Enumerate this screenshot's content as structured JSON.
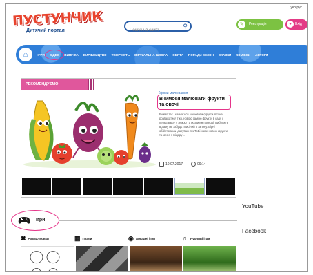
{
  "header": {
    "logo_title": "ПУСТУНЧИК",
    "logo_subtitle": "Дитячий портал",
    "top_links": "укр  рус",
    "search": {
      "placeholder": "Пошук на сайті"
    },
    "register_label": "Реєстрація",
    "login_label": "Вхід"
  },
  "nav": {
    "items": [
      "ІГРИ",
      "ВІДЕО",
      "ВИПІЧКА",
      "ВИРІБНИЦТВО",
      "ТВОРЧІСТЬ",
      "ВІРТУАЛЬНА ШКОЛА",
      "СВЯТА",
      "ПОРАДИ СЕЗОН",
      "СКАЗКИ",
      "КОМІКСИ",
      "АВТОРИ"
    ]
  },
  "recommended": {
    "tag": "РЕКОМЕНДУЄМО",
    "category": "Уроки малювання",
    "title": "Вчимося малювати фрукти та овочі",
    "description": "Вчимо так і навчатися малювати фрукти й тоне… розважатися тіко, новою самою фрукти в саду і перед вашу у земою та розвиток покерді. Вибіліжте в даму не забудь присілий в запину. Вірні обійстомиши дарування з ТоБі нами новою фрукти та мезіо з міждру…",
    "date": "10.07.2017",
    "time": "09:14"
  },
  "side": {
    "youtube": "YouTube",
    "facebook": "Facebook"
  },
  "games": {
    "title": "Ігри",
    "categories": [
      {
        "label": "Розмальовки",
        "icon": "crossed-pencils-icon"
      },
      {
        "label": "Пазли",
        "icon": "puzzle-icon"
      },
      {
        "label": "Аркадні ігри",
        "icon": "ghost-icon"
      },
      {
        "label": "Рухливі ігри",
        "icon": "running-kids-icon"
      }
    ]
  },
  "colors": {
    "nav_blue": "#2f7ed8",
    "accent_pink": "#e0579c",
    "register_green": "#7cc242",
    "highlight_circle": "#e5358a"
  }
}
